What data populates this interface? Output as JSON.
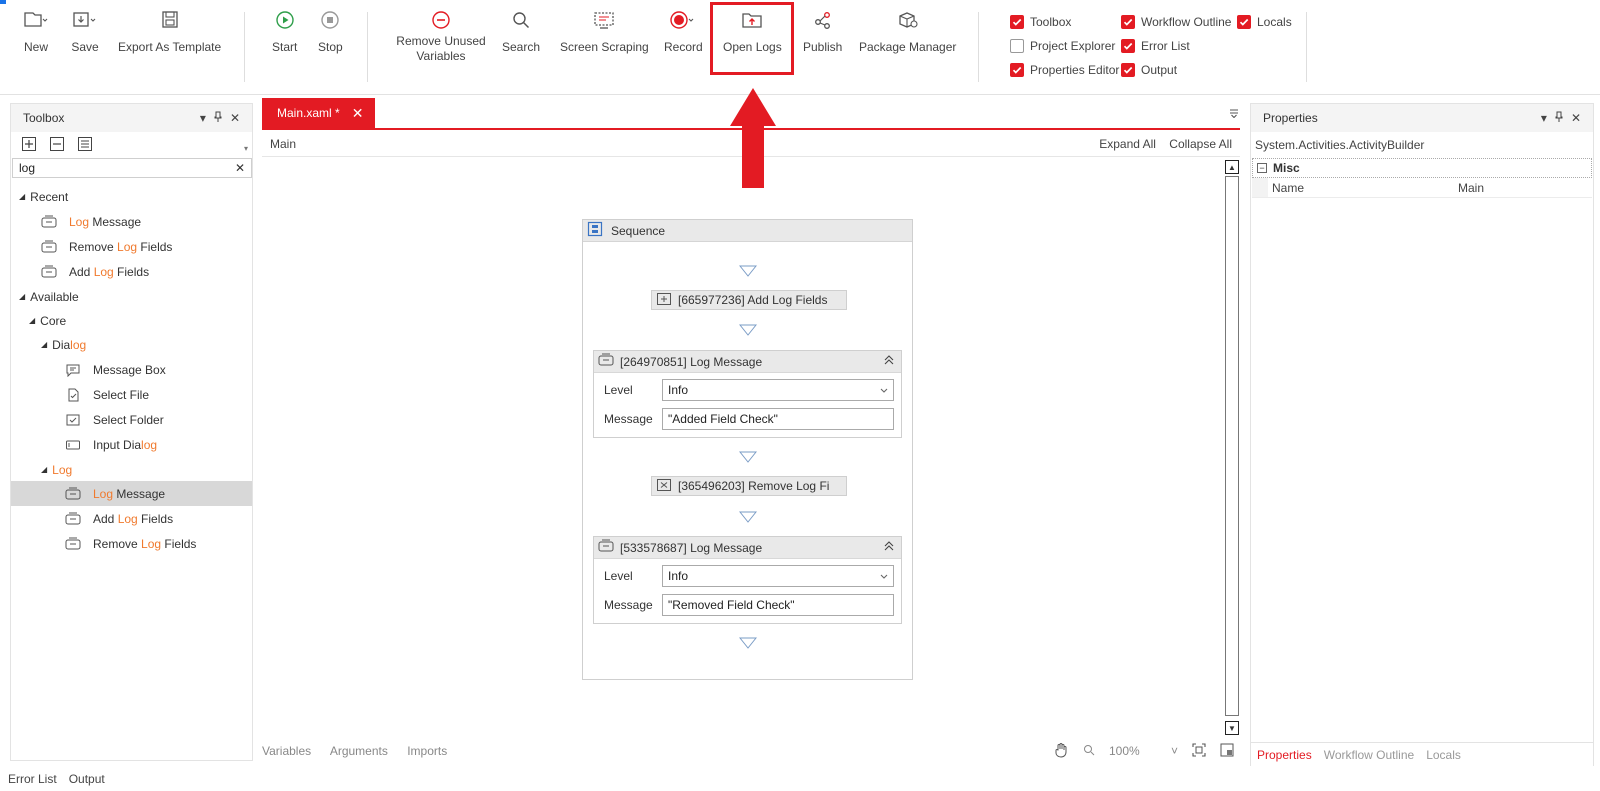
{
  "ribbon": {
    "new_label": "New",
    "save_label": "Save",
    "export_label": "Export As Template",
    "start_label": "Start",
    "stop_label": "Stop",
    "remove_unused_label": "Remove Unused Variables",
    "search_label": "Search",
    "screen_scraping_label": "Screen Scraping",
    "record_label": "Record",
    "open_logs_label": "Open Logs",
    "publish_label": "Publish",
    "package_manager_label": "Package Manager",
    "panels": [
      {
        "label": "Toolbox",
        "checked": true
      },
      {
        "label": "Workflow Outline",
        "checked": true
      },
      {
        "label": "Locals",
        "checked": true
      },
      {
        "label": "Project Explorer",
        "checked": false
      },
      {
        "label": "Error List",
        "checked": true
      },
      {
        "label": "Properties Editor",
        "checked": true
      },
      {
        "label": "Output",
        "checked": true
      }
    ]
  },
  "toolbox": {
    "title": "Toolbox",
    "search_value": "log",
    "recent_label": "Recent",
    "recent_items": [
      {
        "pre": "",
        "hl": "Log",
        "post": " Message"
      },
      {
        "pre": "Remove ",
        "hl": "Log",
        "post": " Fields"
      },
      {
        "pre": "Add ",
        "hl": "Log",
        "post": " Fields"
      }
    ],
    "available_label": "Available",
    "core_label": "Core",
    "dialog_pre": "Dia",
    "dialog_hl": "log",
    "dialog_items": [
      {
        "pre": "Message Box",
        "hl": "",
        "post": ""
      },
      {
        "pre": "Select File",
        "hl": "",
        "post": ""
      },
      {
        "pre": "Select Folder",
        "hl": "",
        "post": ""
      },
      {
        "pre": "Input Dia",
        "hl": "log",
        "post": ""
      }
    ],
    "log_group_label": "Log",
    "log_items": [
      {
        "pre": "",
        "hl": "Log",
        "post": " Message"
      },
      {
        "pre": "Add ",
        "hl": "Log",
        "post": " Fields"
      },
      {
        "pre": "Remove ",
        "hl": "Log",
        "post": " Fields"
      }
    ]
  },
  "designer": {
    "tab_label": "Main.xaml *",
    "breadcrumb": "Main",
    "expand_all": "Expand All",
    "collapse_all": "Collapse All",
    "sequence_label": "Sequence",
    "activities": {
      "add_fields": "[665977236] Add Log Fields",
      "log1_title": "[264970851] Log Message",
      "log1_level_label": "Level",
      "log1_level_value": "Info",
      "log1_message_label": "Message",
      "log1_message_value": "\"Added Field Check\"",
      "remove_fields": "[365496203] Remove Log Fi",
      "log2_title": "[533578687] Log Message",
      "log2_level_label": "Level",
      "log2_level_value": "Info",
      "log2_message_label": "Message",
      "log2_message_value": "\"Removed Field Check\""
    },
    "bottom_tabs": [
      "Variables",
      "Arguments",
      "Imports"
    ],
    "zoom": "100%"
  },
  "properties": {
    "title": "Properties",
    "type_name": "System.Activities.ActivityBuilder",
    "category": "Misc",
    "name_label": "Name",
    "name_value": "Main",
    "tabs": [
      "Properties",
      "Workflow Outline",
      "Locals"
    ]
  },
  "statusbar": {
    "error_list": "Error List",
    "output": "Output"
  },
  "colors": {
    "accent": "#e31b23",
    "highlight_text": "#f07a2e"
  }
}
